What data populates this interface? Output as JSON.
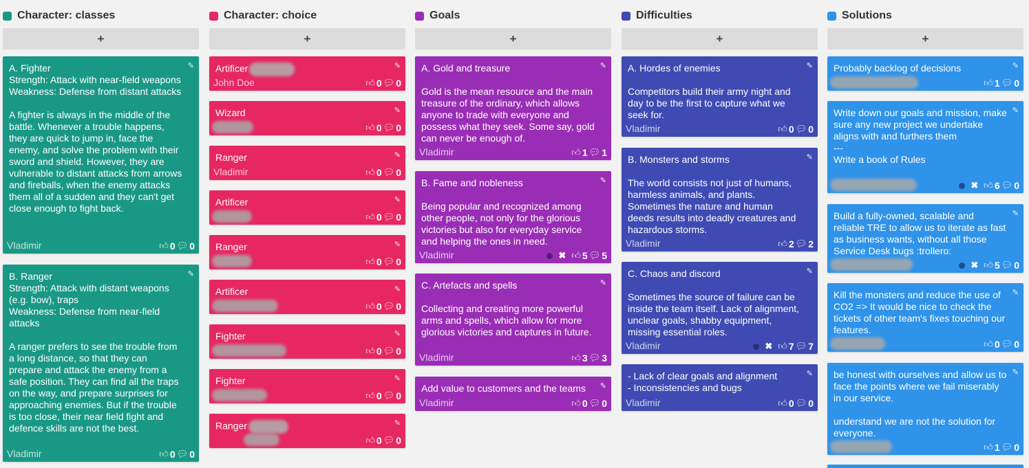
{
  "colors": {
    "teal": "#1a9886",
    "pink": "#e62762",
    "purple": "#9a2db5",
    "indigo": "#3f4bb3",
    "blue": "#2f93ea"
  },
  "add_label": "+",
  "columns": [
    {
      "title": "Character: classes",
      "cards": [
        {
          "text": "A. Fighter\nStrength: Attack with near-field weapons\nWeakness: Defense from distant attacks\n\nA fighter is always in the middle of the battle. Whenever a trouble happens, they are quick to jump in, face the enemy, and solve the problem with their sword and shield. However, they are vulnerable to distant attacks from arrows and fireballs, when the enemy attacks them all of a sudden and they can't get close enough to fight back.",
          "author": "Vladimir",
          "likes": "0",
          "comments": "0"
        },
        {
          "text": "B. Ranger\nStrength: Attack with distant weapons (e.g. bow), traps\nWeakness: Defense from near-field attacks\n\nA ranger prefers to see the trouble from a long distance, so that they can prepare and attack the enemy from a safe position. They can find all the traps on the way, and prepare surprises for approaching enemies. But if the trouble is too close, their near field fight and defence skills are not the best.",
          "author": "Vladimir",
          "likes": "0",
          "comments": "0"
        }
      ]
    },
    {
      "title": "Character: choice",
      "cards": [
        {
          "text": "Artificer",
          "author": "John Doe",
          "likes": "0",
          "comments": "0"
        },
        {
          "text": "Wizard",
          "author": "",
          "likes": "0",
          "comments": "0"
        },
        {
          "text": "Ranger",
          "author": "Vladimir",
          "likes": "0",
          "comments": "0"
        },
        {
          "text": "Artificer",
          "author": "",
          "likes": "0",
          "comments": "0"
        },
        {
          "text": "Ranger",
          "author": "",
          "likes": "0",
          "comments": "0"
        },
        {
          "text": "Artificer",
          "author": "",
          "likes": "0",
          "comments": "0"
        },
        {
          "text": "Fighter",
          "author": "",
          "likes": "0",
          "comments": "0"
        },
        {
          "text": "Fighter",
          "author": "",
          "likes": "0",
          "comments": "0"
        },
        {
          "text": "Ranger",
          "author": "",
          "likes": "0",
          "comments": "0"
        }
      ]
    },
    {
      "title": "Goals",
      "cards": [
        {
          "text": "A. Gold and treasure\n\nGold is the mean resource and the main treasure of the ordinary, which allows anyone to trade with everyone and possess what they seek. Some say, gold can never be enough of.",
          "author": "Vladimir",
          "likes": "1",
          "comments": "1"
        },
        {
          "text": "B. Fame and nobleness\n\nBeing popular and recognized among other people, not only for the glorious victories but also for everyday service and helping the ones in need.",
          "author": "Vladimir",
          "likes": "5",
          "comments": "5"
        },
        {
          "text": "C. Artefacts and spells\n\nCollecting and creating more powerful arms and spells, which allow for more glorious victories and captures in future.",
          "author": "Vladimir",
          "likes": "3",
          "comments": "3"
        },
        {
          "text": "Add value to customers and the teams",
          "author": "Vladimir",
          "likes": "0",
          "comments": "0"
        }
      ]
    },
    {
      "title": "Difficulties",
      "cards": [
        {
          "text": "A. Hordes of enemies\n\nCompetitors build their army night and day to be the first to capture what we seek for.",
          "author": "Vladimir",
          "likes": "0",
          "comments": "0"
        },
        {
          "text": "B. Monsters and storms\n\nThe world consists not just of humans, harmless animals, and plants. Sometimes the nature and human deeds results into deadly creatures and hazardous storms.",
          "author": "Vladimir",
          "likes": "2",
          "comments": "2"
        },
        {
          "text": "C. Chaos and discord\n\nSometimes the source of failure can be inside the team itself. Lack of alignment, unclear goals, shabby equipment, missing essential roles.",
          "author": "Vladimir",
          "likes": "7",
          "comments": "7"
        },
        {
          "text": "- Lack of clear goals and alignment\n- Inconsistencies and bugs",
          "author": "Vladimir",
          "likes": "0",
          "comments": "0"
        }
      ]
    },
    {
      "title": "Solutions",
      "cards": [
        {
          "text": "Probably backlog of decisions",
          "author": "",
          "likes": "1",
          "comments": "0"
        },
        {
          "text": "Write down our goals and mission, make sure any new project we undertake aligns with and furthers them\n---\nWrite a book of Rules",
          "author": "",
          "likes": "6",
          "comments": "0"
        },
        {
          "text": "Build a fully-owned, scalable and reliable TRE to allow us to iterate as fast as business wants, without all those Service Desk bugs :trollero:",
          "author": "",
          "likes": "5",
          "comments": "0"
        },
        {
          "text": "Kill the monsters and reduce the use of CO2 => It would be nice to check the tickets of other team's fixes touching our features.",
          "author": "",
          "likes": "0",
          "comments": "0"
        },
        {
          "text": "be honest with ourselves and allow us to face the points where we fail miserably in our service.\n\nunderstand we are not the solution for everyone.",
          "author": "",
          "likes": "1",
          "comments": "0"
        }
      ]
    }
  ]
}
